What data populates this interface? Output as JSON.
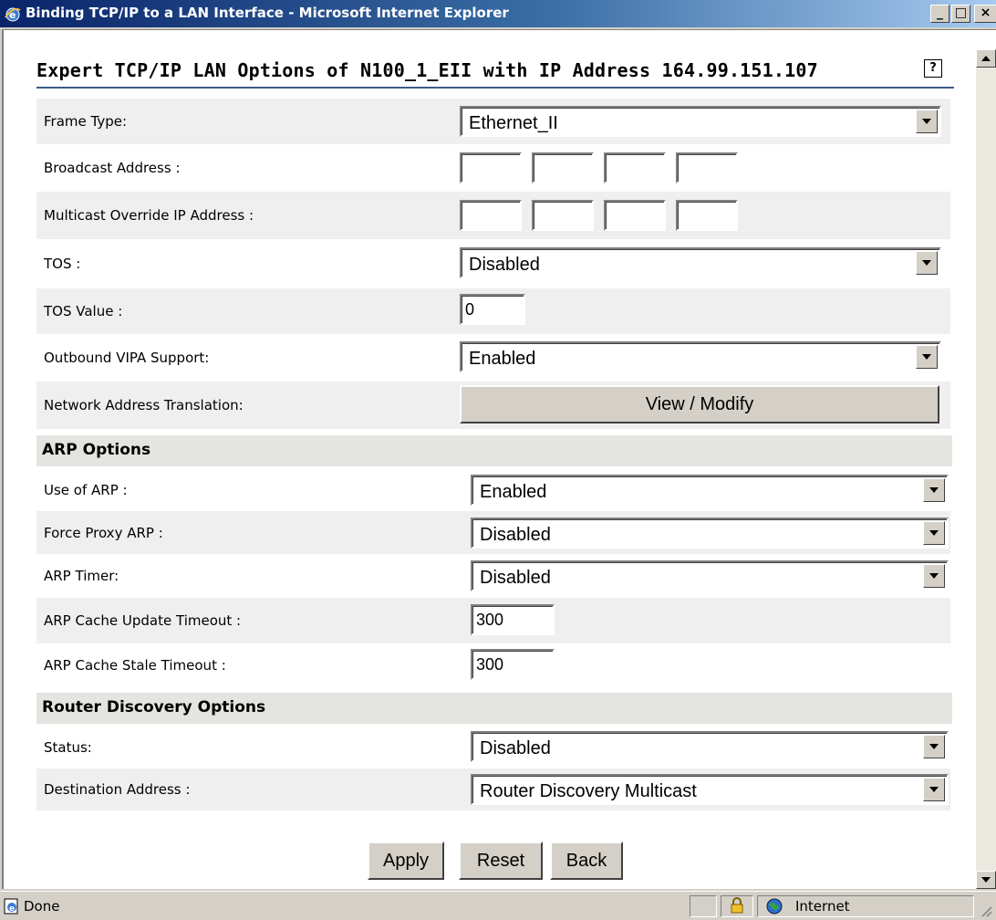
{
  "window": {
    "title": "Binding TCP/IP to a LAN Interface - Microsoft Internet Explorer",
    "minimize": "_",
    "maximize": "□",
    "close": "×"
  },
  "page": {
    "heading": "Expert TCP/IP LAN Options of N100_1_EII with IP Address 164.99.151.107",
    "help": "?"
  },
  "fields": {
    "frame_type": {
      "label": "Frame Type:",
      "value": "Ethernet_II"
    },
    "broadcast_address": {
      "label": "Broadcast Address :",
      "octets": [
        "",
        "",
        "",
        ""
      ]
    },
    "multicast_override": {
      "label": "Multicast Override IP Address :",
      "octets": [
        "",
        "",
        "",
        ""
      ]
    },
    "tos": {
      "label": "TOS :",
      "value": "Disabled"
    },
    "tos_value": {
      "label": "TOS Value :",
      "value": "0"
    },
    "outbound_vipa": {
      "label": "Outbound VIPA Support:",
      "value": "Enabled"
    },
    "nat": {
      "label": "Network Address Translation:",
      "button": "View / Modify"
    }
  },
  "arp": {
    "section_title": "ARP Options",
    "use_of_arp": {
      "label": "Use of ARP :",
      "value": "Enabled"
    },
    "force_proxy_arp": {
      "label": "Force Proxy ARP :",
      "value": "Disabled"
    },
    "arp_timer": {
      "label": "ARP Timer:",
      "value": "Disabled"
    },
    "cache_update_timeout": {
      "label": "ARP Cache Update Timeout :",
      "value": "300"
    },
    "cache_stale_timeout": {
      "label": "ARP Cache Stale Timeout :",
      "value": "300"
    }
  },
  "router_discovery": {
    "section_title": "Router Discovery Options",
    "status": {
      "label": "Status:",
      "value": "Disabled"
    },
    "destination_address": {
      "label": "Destination Address :",
      "value": "Router Discovery Multicast"
    }
  },
  "actions": {
    "apply": "Apply",
    "reset": "Reset",
    "back": "Back"
  },
  "statusbar": {
    "text": "Done",
    "zone": "Internet"
  },
  "icons": {
    "title": "ie-logo-icon",
    "help": "help-icon",
    "status": "page-done-icon",
    "lock": "lock-icon",
    "zone": "globe-icon"
  }
}
